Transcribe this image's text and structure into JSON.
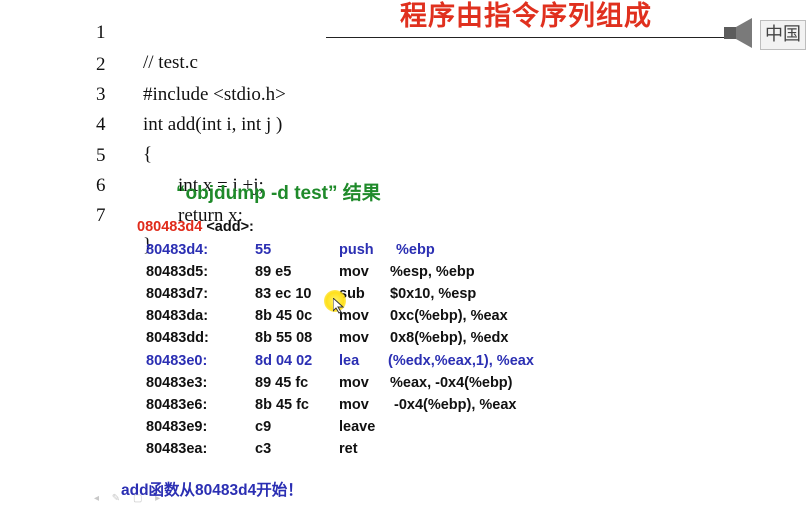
{
  "slide": {
    "title": "程序由指令序列组成",
    "language_badge": "中国"
  },
  "source_code": [
    {
      "line": "1",
      "text": "// test.c"
    },
    {
      "line": "2",
      "text": "#include <stdio.h>"
    },
    {
      "line": "3",
      "text": "int add(int i, int j )"
    },
    {
      "line": "4",
      "text": "{"
    },
    {
      "line": "5",
      "text": "int x = i +j;"
    },
    {
      "line": "6",
      "text": "return x:"
    },
    {
      "line": "7",
      "text": "}"
    }
  ],
  "objdump_caption": "“objdump -d test” 结果",
  "disassembly": {
    "function_address": "080483d4",
    "function_label": "<add>:",
    "rows": [
      {
        "addr": "80483d4:",
        "bytes": "55",
        "mnemonic": "push",
        "operands": "%ebp"
      },
      {
        "addr": "80483d5:",
        "bytes": "89 e5",
        "mnemonic": "mov",
        "operands": "%esp, %ebp"
      },
      {
        "addr": "80483d7:",
        "bytes": "83 ec 10",
        "mnemonic": "sub",
        "operands": "$0x10, %esp"
      },
      {
        "addr": "80483da:",
        "bytes": "8b 45 0c",
        "mnemonic": "mov",
        "operands": "0xc(%ebp), %eax"
      },
      {
        "addr": "80483dd:",
        "bytes": "8b 55 08",
        "mnemonic": "mov",
        "operands": "0x8(%ebp), %edx"
      },
      {
        "addr": "80483e0:",
        "bytes": "8d 04 02",
        "mnemonic": "lea",
        "operands": "(%edx,%eax,1), %eax"
      },
      {
        "addr": "80483e3:",
        "bytes": "89 45 fc",
        "mnemonic": "mov",
        "operands": "%eax, -0x4(%ebp)"
      },
      {
        "addr": "80483e6:",
        "bytes": "8b 45 fc",
        "mnemonic": "mov",
        "operands": "-0x4(%ebp), %eax"
      },
      {
        "addr": "80483e9:",
        "bytes": "c9",
        "mnemonic": "leave",
        "operands": ""
      },
      {
        "addr": "80483ea:",
        "bytes": "c3",
        "mnemonic": "ret",
        "operands": ""
      }
    ]
  },
  "footer_note": "add函数从80483d4开始！",
  "player": {
    "controls": "◂ ✎ ▢ ▸"
  },
  "colors": {
    "title": "#e0301e",
    "caption": "#1f8a2a",
    "function_address": "#e02b1b",
    "highlighted_row": "#2b2fb3"
  }
}
